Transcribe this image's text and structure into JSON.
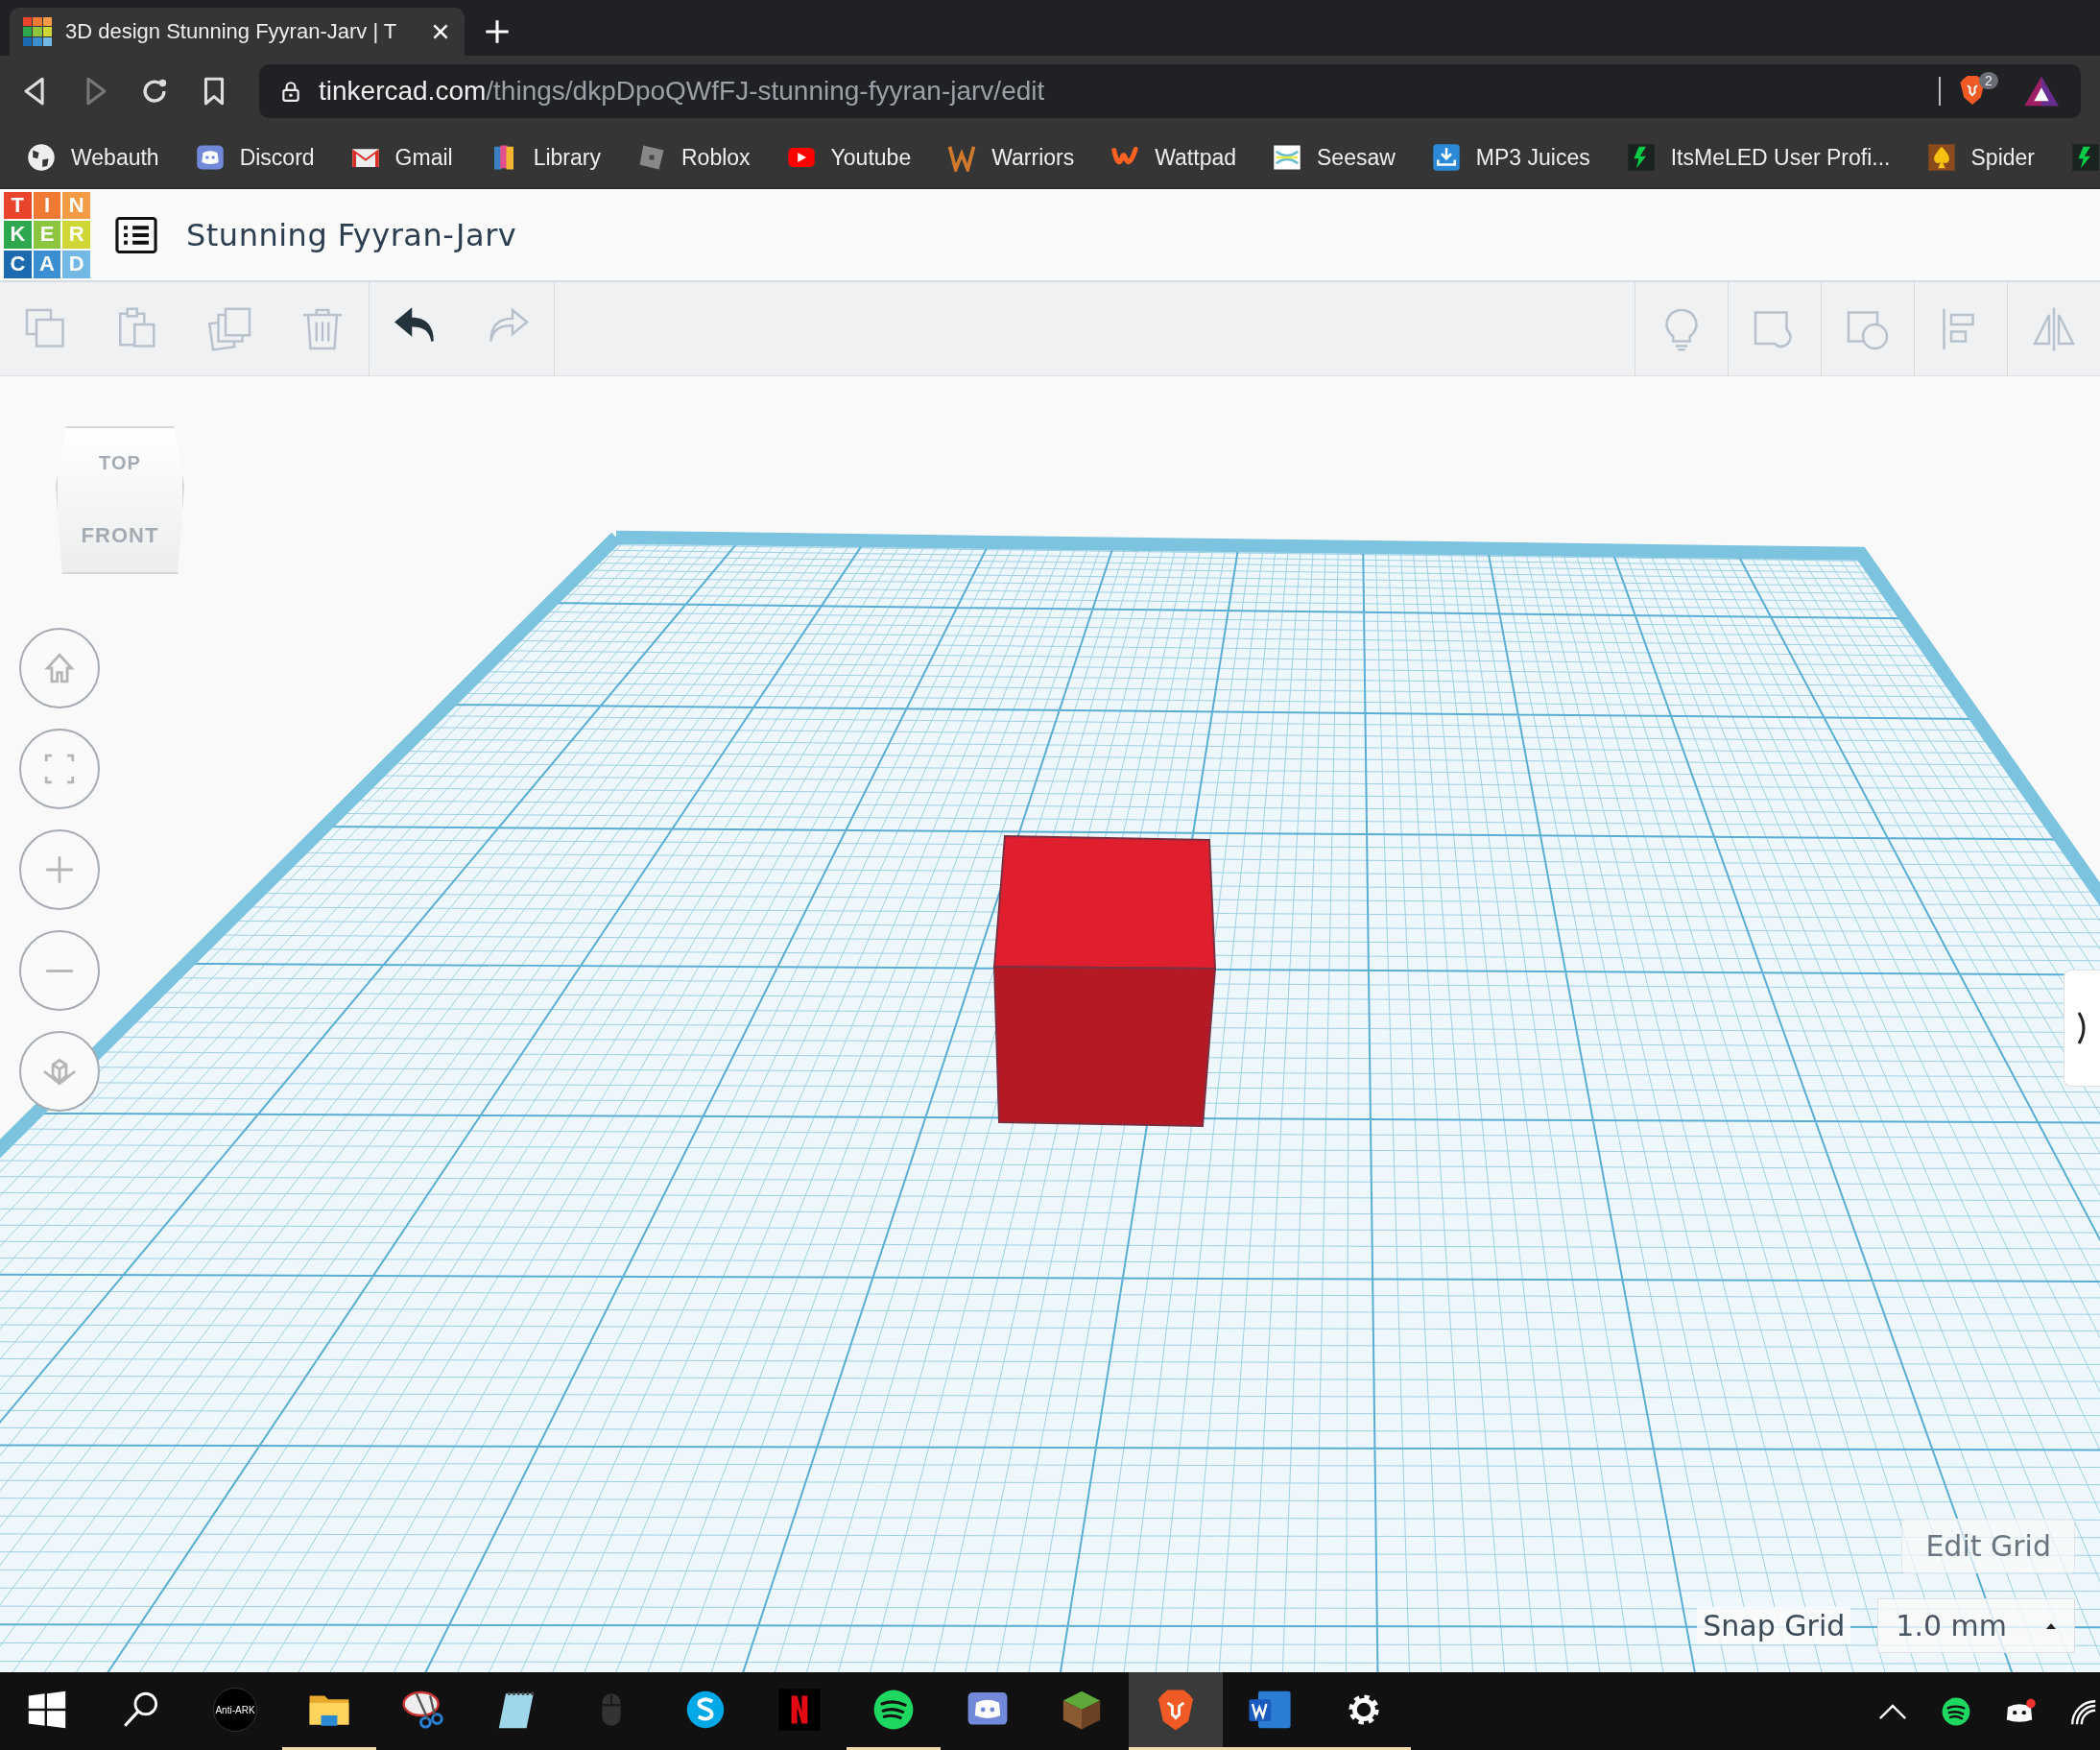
{
  "browser": {
    "tab": {
      "title": "3D design Stunning Fyyran-Jarv | T"
    },
    "address": {
      "domain": "tinkercad.com",
      "path": "/things/dkpDpoQWfFJ-stunning-fyyran-jarv/edit"
    },
    "extension_badge": "2",
    "bookmarks": [
      {
        "kind": "globe",
        "label": "Webauth"
      },
      {
        "kind": "discord",
        "label": "Discord"
      },
      {
        "kind": "gmail",
        "label": "Gmail"
      },
      {
        "kind": "library",
        "label": "Library"
      },
      {
        "kind": "roblox",
        "label": "Roblox"
      },
      {
        "kind": "youtube",
        "label": "Youtube"
      },
      {
        "kind": "warriors",
        "label": "Warriors"
      },
      {
        "kind": "wattpad",
        "label": "Wattpad"
      },
      {
        "kind": "seesaw",
        "label": "Seesaw"
      },
      {
        "kind": "download",
        "label": "MP3 Juices"
      },
      {
        "kind": "deviant",
        "label": "ItsMeLED User Profi..."
      },
      {
        "kind": "spade",
        "label": "Spider"
      },
      {
        "kind": "deviant"
      }
    ]
  },
  "app": {
    "logo_letters": [
      "T",
      "I",
      "N",
      "K",
      "E",
      "R",
      "C",
      "A",
      "D"
    ],
    "design_title": "Stunning Fyyran-Jarv"
  },
  "toolbar": {
    "left": [
      {
        "kind": "copy",
        "disabled": true
      },
      {
        "kind": "paste",
        "disabled": true
      },
      {
        "kind": "duplicate",
        "disabled": true
      },
      {
        "kind": "delete",
        "disabled": true
      },
      {
        "kind": "undo",
        "disabled": false
      },
      {
        "kind": "redo",
        "disabled": true
      }
    ],
    "right": [
      {
        "kind": "bulb",
        "disabled": true
      },
      {
        "kind": "group",
        "disabled": true
      },
      {
        "kind": "ungroup",
        "disabled": true
      },
      {
        "kind": "align",
        "disabled": true
      },
      {
        "kind": "mirror",
        "disabled": true
      }
    ]
  },
  "view_cube": {
    "top": "TOP",
    "front": "FRONT"
  },
  "view_controls": [
    {
      "kind": "home"
    },
    {
      "kind": "fit"
    },
    {
      "kind": "zoom_in"
    },
    {
      "kind": "zoom_out"
    },
    {
      "kind": "ortho"
    }
  ],
  "grid_controls": {
    "edit_grid": "Edit Grid",
    "snap_label": "Snap Grid",
    "snap_value": "1.0 mm"
  },
  "taskbar": [
    {
      "kind": "start",
      "open": false
    },
    {
      "kind": "search",
      "open": false
    },
    {
      "kind": "antiark",
      "label": "Anti-ARK",
      "open": false
    },
    {
      "kind": "folder",
      "open": true
    },
    {
      "kind": "snip",
      "open": false
    },
    {
      "kind": "notepad",
      "open": false
    },
    {
      "kind": "mouse",
      "open": false
    },
    {
      "kind": "skype",
      "open": false
    },
    {
      "kind": "netflix",
      "open": false
    },
    {
      "kind": "spotify",
      "open": true
    },
    {
      "kind": "discord",
      "open": false
    },
    {
      "kind": "minecraft",
      "open": false
    },
    {
      "kind": "brave",
      "open": true,
      "selected": true
    },
    {
      "kind": "word",
      "open": true,
      "selected": false
    },
    {
      "kind": "settings",
      "open": true,
      "selected": false
    }
  ],
  "tray": [
    {
      "kind": "chevron"
    },
    {
      "kind": "spotify"
    },
    {
      "kind": "discord"
    },
    {
      "kind": "wifi"
    }
  ]
}
